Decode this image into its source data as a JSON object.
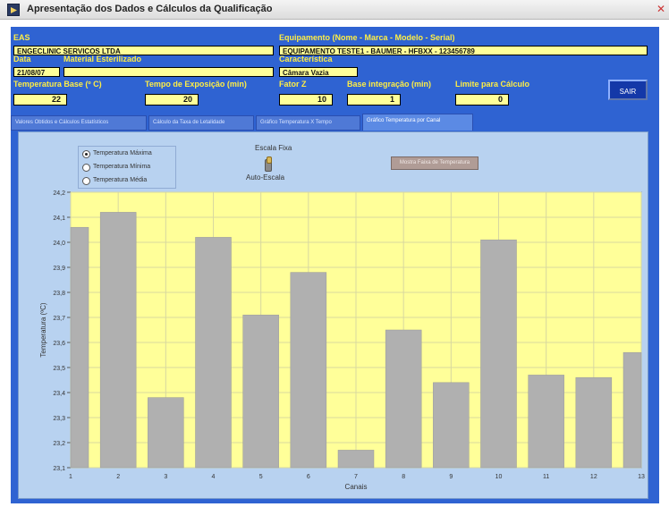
{
  "window": {
    "title": "Apresentação dos Dados e Cálculos da Qualificação"
  },
  "header": {
    "eas_label": "EAS",
    "eas_value": "ENGECLINIC SERVICOS LTDA",
    "equipamento_label": "Equipamento (Nome - Marca - Modelo - Serial)",
    "equipamento_value": "EQUIPAMENTO TESTE1 - BAUMER - HFBXX - 123456789",
    "data_label": "Data",
    "data_value": "21/08/07",
    "material_label": "Material Esterilizado",
    "material_value": "",
    "caracteristica_label": "Característica",
    "caracteristica_value": "Câmara Vazia",
    "temp_base_label": "Temperatura Base (º C)",
    "temp_base_value": "22",
    "tempo_label": "Tempo de Exposição (min)",
    "tempo_value": "20",
    "fator_label": "Fator Z",
    "fator_value": "10",
    "base_int_label": "Base integração (min)",
    "base_int_value": "1",
    "limite_label": "Limite para Cálculo",
    "limite_value": "0",
    "sair_label": "SAIR"
  },
  "tabs": [
    {
      "label": "Valores Obtidos e Cálculos Estatísticos",
      "active": false
    },
    {
      "label": "Cálculo da Taxa de Letalidade",
      "active": false
    },
    {
      "label": "Gráfico Temperatura X Tempo",
      "active": false
    },
    {
      "label": "Gráfico Temperatura por Canal",
      "active": true
    }
  ],
  "controls": {
    "radio_options": [
      {
        "label": "Temperatura Máxima",
        "selected": true
      },
      {
        "label": "Temperatura Mínima",
        "selected": false
      },
      {
        "label": "Temperatura Média",
        "selected": false
      }
    ],
    "toggle_top_label": "Escala Fixa",
    "toggle_bottom_label": "Auto-Escala",
    "mostrar_button": "Mostra Faixa de Temperatura"
  },
  "colors": {
    "window_bg": "#2f63d2",
    "panel_bg": "#b8d2f0",
    "plot_bg": "#ffff99",
    "bar": "#b0b0b0",
    "label_yellow": "#ffee44"
  },
  "chart_data": {
    "type": "bar",
    "xlabel": "Canais",
    "ylabel": "Temperatura (ºC)",
    "ylim": [
      23.1,
      24.2
    ],
    "y_ticks": [
      "23,1",
      "23,2",
      "23,3",
      "23,4",
      "23,5",
      "23,6",
      "23,7",
      "23,8",
      "23,9",
      "24,0",
      "24,1",
      "24,2"
    ],
    "categories": [
      "1",
      "2",
      "3",
      "4",
      "5",
      "6",
      "7",
      "8",
      "9",
      "10",
      "11",
      "12",
      "13"
    ],
    "values": [
      24.06,
      24.12,
      23.38,
      24.02,
      23.71,
      23.88,
      23.17,
      23.65,
      23.44,
      24.01,
      23.47,
      23.46,
      23.56
    ],
    "grid": true
  }
}
